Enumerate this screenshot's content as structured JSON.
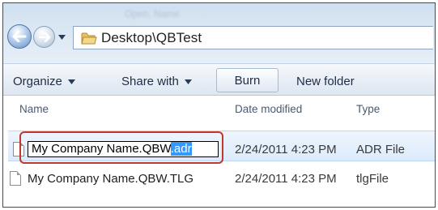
{
  "window": {
    "title_blurred": "Open, Name"
  },
  "navigation": {
    "back_icon": "back-arrow-icon",
    "forward_icon": "forward-arrow-icon",
    "recent_icon": "chevron-down-icon",
    "address_icon": "folder-icon",
    "address_path": "Desktop\\QBTest"
  },
  "toolbar": {
    "organize_label": "Organize",
    "share_label": "Share with",
    "burn_label": "Burn",
    "new_folder_label": "New folder"
  },
  "columns": {
    "name": "Name",
    "date": "Date modified",
    "type": "Type"
  },
  "files": [
    {
      "name_base": "My Company Name.QBW",
      "name_ext": ".adr",
      "date": "2/24/2011 4:23 PM",
      "type": "ADR File",
      "editing": true
    },
    {
      "name": "My Company Name.QBW.TLG",
      "date": "2/24/2011 4:23 PM",
      "type": "tlgFile"
    }
  ],
  "colors": {
    "highlight": "#c0392b",
    "selection": "#3399ff"
  }
}
